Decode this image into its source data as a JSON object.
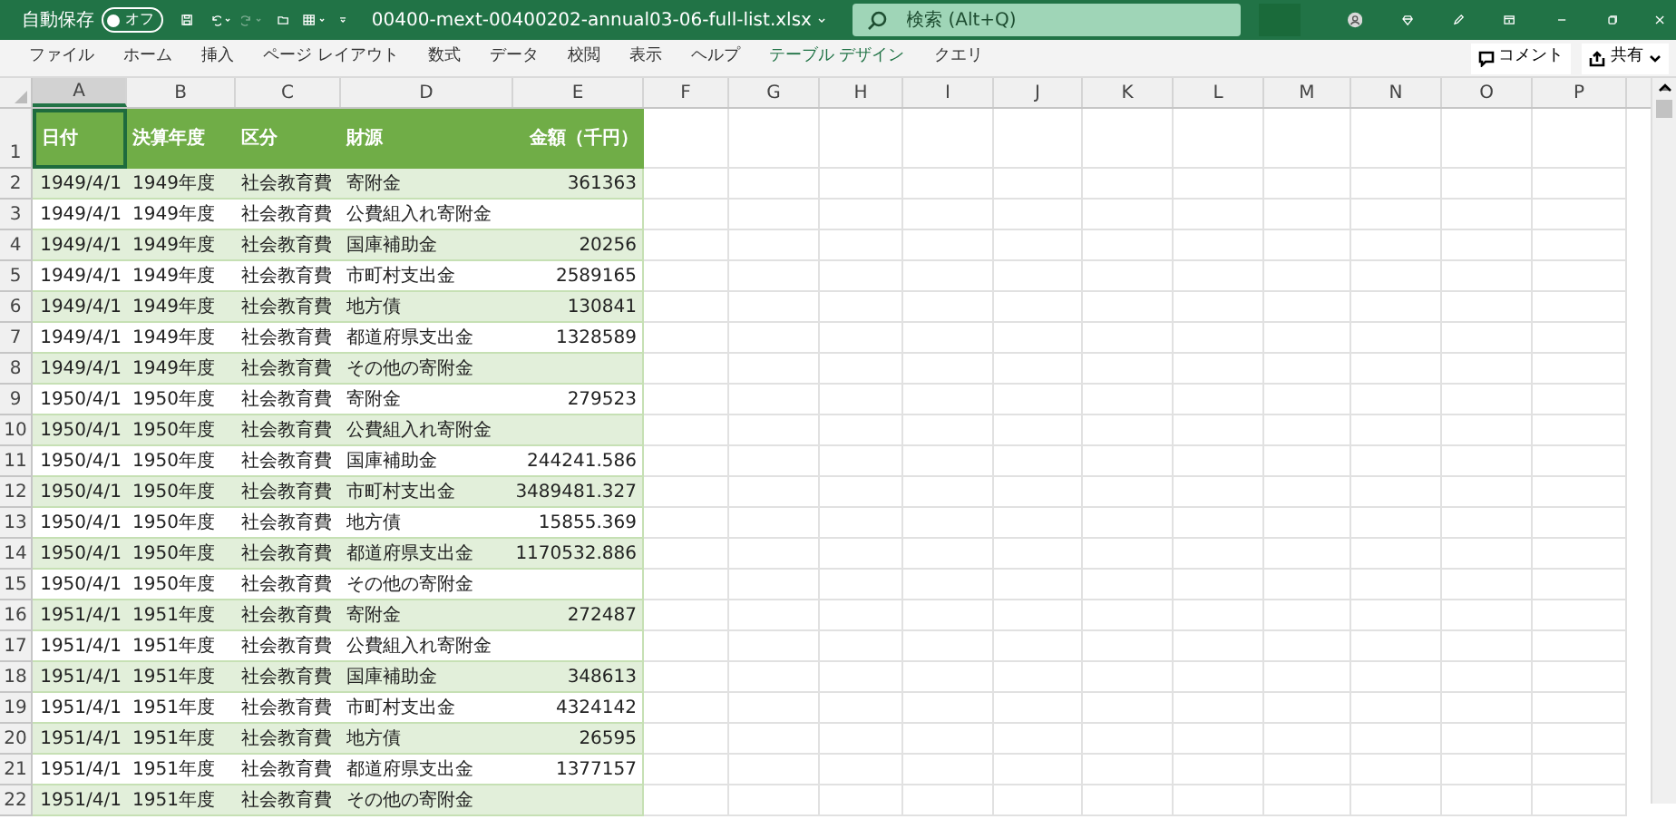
{
  "title_bar": {
    "autosave_label": "自動保存",
    "autosave": {
      "label": "オフ",
      "on": false
    },
    "filename": "00400-mext-00400202-annual03-06-full-list.xlsx",
    "search": {
      "placeholder": "検索 (Alt+Q)"
    }
  },
  "ribbon_tabs": [
    {
      "label": "ファイル",
      "kind": "normal"
    },
    {
      "label": "ホーム",
      "kind": "normal"
    },
    {
      "label": "挿入",
      "kind": "normal"
    },
    {
      "label": "ページ レイアウト",
      "kind": "normal"
    },
    {
      "label": "数式",
      "kind": "normal"
    },
    {
      "label": "データ",
      "kind": "normal"
    },
    {
      "label": "校閲",
      "kind": "normal"
    },
    {
      "label": "表示",
      "kind": "normal"
    },
    {
      "label": "ヘルプ",
      "kind": "normal"
    },
    {
      "label": "テーブル デザイン",
      "kind": "contextual"
    },
    {
      "label": "クエリ",
      "kind": "normal"
    }
  ],
  "comment_button": "コメント",
  "share_button": "共有",
  "columns": [
    {
      "label": "A",
      "selected": true
    },
    {
      "label": "B",
      "selected": false
    },
    {
      "label": "C",
      "selected": false
    },
    {
      "label": "D",
      "selected": false
    },
    {
      "label": "E",
      "selected": false
    },
    {
      "label": "F",
      "selected": false
    },
    {
      "label": "G",
      "selected": false
    },
    {
      "label": "H",
      "selected": false
    },
    {
      "label": "I",
      "selected": false
    },
    {
      "label": "J",
      "selected": false
    },
    {
      "label": "K",
      "selected": false
    },
    {
      "label": "L",
      "selected": false
    },
    {
      "label": "M",
      "selected": false
    },
    {
      "label": "N",
      "selected": false
    },
    {
      "label": "O",
      "selected": false
    },
    {
      "label": "P",
      "selected": false
    }
  ],
  "table": {
    "header_row": "1",
    "headers": [
      "日付",
      "決算年度",
      "区分",
      "財源",
      "金額（千円）"
    ],
    "rows": [
      {
        "row": "2",
        "cells": [
          "1949/4/1",
          "1949年度",
          "社会教育費",
          "寄附金",
          "361363"
        ]
      },
      {
        "row": "3",
        "cells": [
          "1949/4/1",
          "1949年度",
          "社会教育費",
          "公費組入れ寄附金",
          ""
        ]
      },
      {
        "row": "4",
        "cells": [
          "1949/4/1",
          "1949年度",
          "社会教育費",
          "国庫補助金",
          "20256"
        ]
      },
      {
        "row": "5",
        "cells": [
          "1949/4/1",
          "1949年度",
          "社会教育費",
          "市町村支出金",
          "2589165"
        ]
      },
      {
        "row": "6",
        "cells": [
          "1949/4/1",
          "1949年度",
          "社会教育費",
          "地方債",
          "130841"
        ]
      },
      {
        "row": "7",
        "cells": [
          "1949/4/1",
          "1949年度",
          "社会教育費",
          "都道府県支出金",
          "1328589"
        ]
      },
      {
        "row": "8",
        "cells": [
          "1949/4/1",
          "1949年度",
          "社会教育費",
          "その他の寄附金",
          ""
        ]
      },
      {
        "row": "9",
        "cells": [
          "1950/4/1",
          "1950年度",
          "社会教育費",
          "寄附金",
          "279523"
        ]
      },
      {
        "row": "10",
        "cells": [
          "1950/4/1",
          "1950年度",
          "社会教育費",
          "公費組入れ寄附金",
          ""
        ]
      },
      {
        "row": "11",
        "cells": [
          "1950/4/1",
          "1950年度",
          "社会教育費",
          "国庫補助金",
          "244241.586"
        ]
      },
      {
        "row": "12",
        "cells": [
          "1950/4/1",
          "1950年度",
          "社会教育費",
          "市町村支出金",
          "3489481.327"
        ]
      },
      {
        "row": "13",
        "cells": [
          "1950/4/1",
          "1950年度",
          "社会教育費",
          "地方債",
          "15855.369"
        ]
      },
      {
        "row": "14",
        "cells": [
          "1950/4/1",
          "1950年度",
          "社会教育費",
          "都道府県支出金",
          "1170532.886"
        ]
      },
      {
        "row": "15",
        "cells": [
          "1950/4/1",
          "1950年度",
          "社会教育費",
          "その他の寄附金",
          ""
        ]
      },
      {
        "row": "16",
        "cells": [
          "1951/4/1",
          "1951年度",
          "社会教育費",
          "寄附金",
          "272487"
        ]
      },
      {
        "row": "17",
        "cells": [
          "1951/4/1",
          "1951年度",
          "社会教育費",
          "公費組入れ寄附金",
          ""
        ]
      },
      {
        "row": "18",
        "cells": [
          "1951/4/1",
          "1951年度",
          "社会教育費",
          "国庫補助金",
          "348613"
        ]
      },
      {
        "row": "19",
        "cells": [
          "1951/4/1",
          "1951年度",
          "社会教育費",
          "市町村支出金",
          "4324142"
        ]
      },
      {
        "row": "20",
        "cells": [
          "1951/4/1",
          "1951年度",
          "社会教育費",
          "地方債",
          "26595"
        ]
      },
      {
        "row": "21",
        "cells": [
          "1951/4/1",
          "1951年度",
          "社会教育費",
          "都道府県支出金",
          "1377157"
        ]
      },
      {
        "row": "22",
        "cells": [
          "1951/4/1",
          "1951年度",
          "社会教育費",
          "その他の寄附金",
          ""
        ]
      }
    ]
  }
}
